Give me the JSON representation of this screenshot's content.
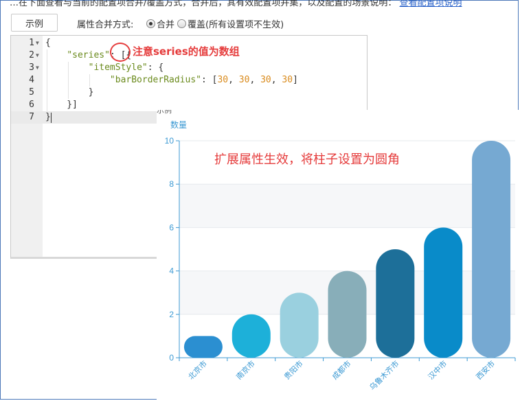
{
  "header": {
    "cut_text": "…在下面查看与当前的配置项合并/覆盖方式，合并后，其有效配置项并集，以及配置的场景说明：",
    "cut_link": "查看配置项说明"
  },
  "toolbar": {
    "example_label": "示例",
    "merge_label": "属性合并方式:",
    "merge_option_label": "合并",
    "overwrite_option_label": "覆盖(所有设置项不生效)",
    "selected": "merge"
  },
  "editor": {
    "line_numbers": [
      "1",
      "2",
      "3",
      "4",
      "5",
      "6",
      "7"
    ],
    "lines": [
      "{",
      "    \"series\": [{",
      "        \"itemStyle\": {",
      "            \"barBorderRadius\": [30, 30, 30, 30]",
      "        }",
      "    }]",
      "}"
    ],
    "active_line": 7
  },
  "annotations": {
    "series_note": "注意series的值为数组",
    "chart_note": "扩展属性生效，将柱子设置为圆角",
    "partial_label": "示例"
  },
  "chart_data": {
    "type": "bar",
    "ylabel": "数量",
    "ylim": [
      0,
      10
    ],
    "yticks": [
      0,
      2,
      4,
      6,
      8,
      10
    ],
    "categories": [
      "北京市",
      "南京市",
      "贵阳市",
      "成都市",
      "乌鲁木齐市",
      "汉中市",
      "西安市"
    ],
    "values": [
      1,
      2,
      3,
      4,
      5,
      6,
      10
    ],
    "colors": [
      "#2b8fd1",
      "#1db0d9",
      "#9ad0df",
      "#88aeb9",
      "#1d6f99",
      "#098bc9",
      "#76a9d2"
    ],
    "grid": true,
    "axis_color": "#3b99d3"
  },
  "colors": {
    "accent": "#e53b3b",
    "frame": "#4a76b8"
  }
}
